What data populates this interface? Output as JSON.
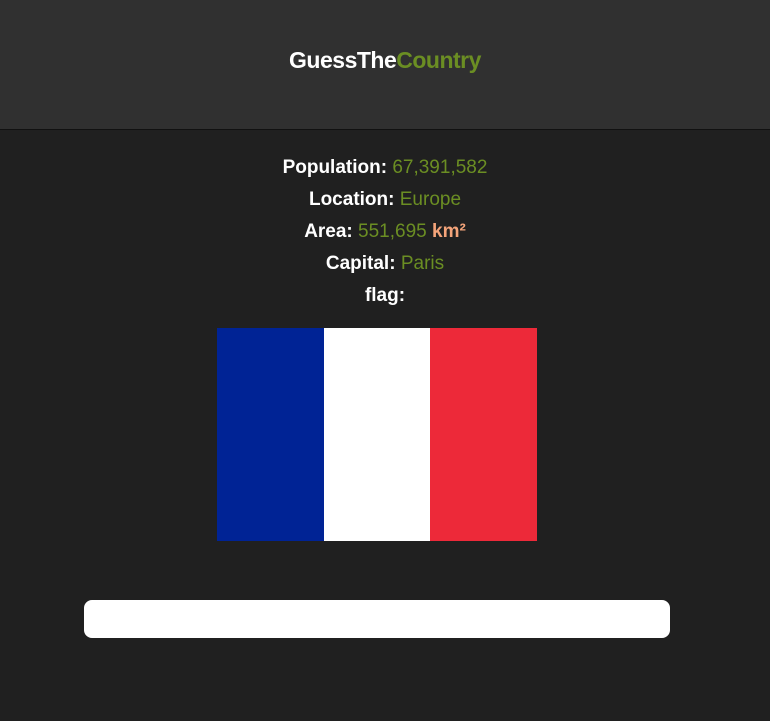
{
  "header": {
    "logo_part1": "GuessThe",
    "logo_part2": "Country",
    "accent_color": "#6b8e23"
  },
  "info": {
    "population_label": "Population:",
    "population_value": "67,391,582",
    "location_label": "Location:",
    "location_value": "Europe",
    "area_label": "Area:",
    "area_value": "551,695",
    "area_unit": "km²",
    "capital_label": "Capital:",
    "capital_value": "Paris",
    "flag_label": "flag:"
  },
  "flag": {
    "country": "France",
    "stripes": [
      "#002395",
      "#ffffff",
      "#ed2939"
    ]
  },
  "guess": {
    "value": "",
    "placeholder": ""
  }
}
